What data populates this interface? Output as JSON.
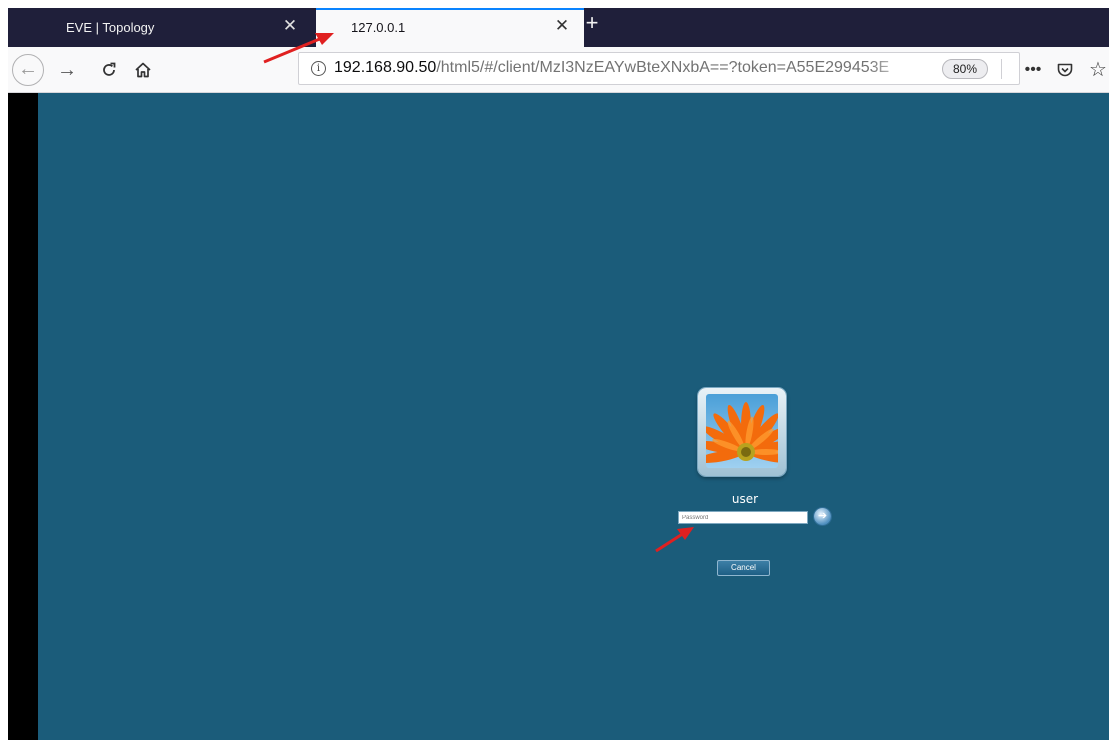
{
  "browser": {
    "tabs": [
      {
        "title": "EVE | Topology",
        "active": false
      },
      {
        "title": "127.0.0.1",
        "active": true
      }
    ],
    "new_tab_icon": "plus-icon",
    "url": {
      "host": "192.168.90.50",
      "path": "/html5/#/client/MzI3NzEAYwBteXNxbA==?token=A55E299453E"
    },
    "zoom": "80%"
  },
  "remote_desktop": {
    "username": "user",
    "password_placeholder": "Password",
    "cancel_label": "Cancel"
  },
  "colors": {
    "desktop_background": "#1b5c7a",
    "tabstrip": "#1f1f3a",
    "active_tab_accent": "#0a84ff",
    "annotation_arrow": "#e02020"
  }
}
